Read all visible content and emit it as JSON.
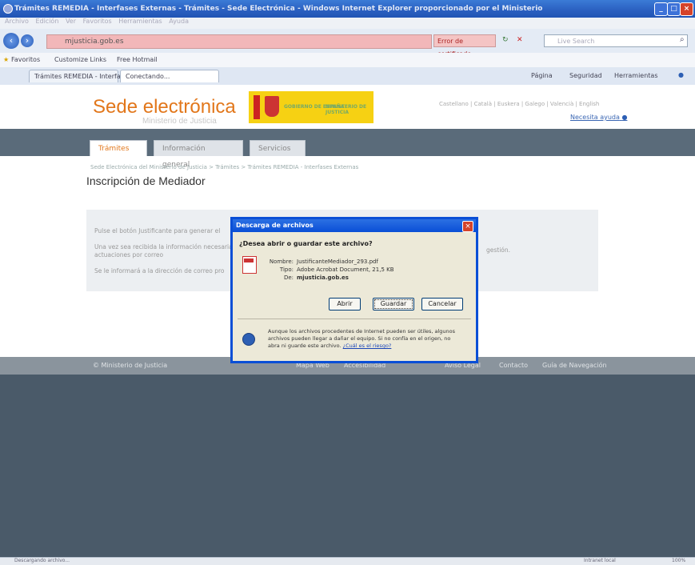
{
  "window": {
    "title": "Trámites REMEDIA - Interfases Externas - Trámites - Sede Electrónica - Windows Internet Explorer proporcionado por el Ministerio"
  },
  "menubar": [
    "Archivo",
    "Edición",
    "Ver",
    "Favoritos",
    "Herramientas",
    "Ayuda"
  ],
  "address": {
    "url": "mjusticia.gob.es",
    "cert_error": "Error de certificado",
    "search_placeholder": "Live Search"
  },
  "favorites": {
    "label": "Favoritos",
    "items": [
      "Customize Links",
      "Free Hotmail"
    ]
  },
  "tabs": {
    "items": [
      "Trámites REMEDIA - Interfas...",
      "Conectando..."
    ],
    "tools": [
      "Página",
      "Seguridad",
      "Herramientas"
    ]
  },
  "site": {
    "brand": "Sede electrónica",
    "ministry": "Ministerio de Justicia",
    "logo_gob": "GOBIERNO DE ESPAÑA",
    "logo_min": "MINISTERIO DE JUSTICIA",
    "languages": "Castellano | Català | Euskera | Galego | Valencià | English",
    "help": "Necesita ayuda"
  },
  "nav": [
    "Trámites",
    "Información general",
    "Servicios"
  ],
  "breadcrumb": "Sede Electrónica del Ministerio de Justicia > Trámites > Trámites REMEDIA - Interfases Externas",
  "page_title": "Inscripción de Mediador",
  "info": {
    "line1": "Pulse el botón Justificante para generar el",
    "line2": "Una vez sea recibida la información necesaria",
    "line3": "actuaciones por correo",
    "line4": "Se le informará a la dirección de correo pro",
    "right": "gestión."
  },
  "footer": {
    "items": [
      "© Ministerio de Justicia",
      "Mapa Web",
      "Accesibilidad",
      "Aviso Legal",
      "Contacto",
      "Guía de Navegación"
    ]
  },
  "dialog": {
    "title": "Descarga de archivos",
    "question": "¿Desea abrir o guardar este archivo?",
    "name_label": "Nombre:",
    "name_value": "JustificanteMediador_293.pdf",
    "type_label": "Tipo:",
    "type_value": "Adobe Acrobat Document, 21,5 KB",
    "from_label": "De:",
    "from_value": "mjusticia.gob.es",
    "btn_open": "Abrir",
    "btn_save": "Guardar",
    "btn_cancel": "Cancelar",
    "warning": "Aunque los archivos procedentes de Internet pueden ser útiles, algunos archivos pueden llegar a dañar el equipo. Si no confía en el origen, no abra ni guarde este archivo.",
    "warning_link": "¿Cuál es el riesgo?"
  },
  "status": {
    "text": "Descargando archivo...",
    "zone": "Intranet local",
    "zoom": "100%"
  }
}
